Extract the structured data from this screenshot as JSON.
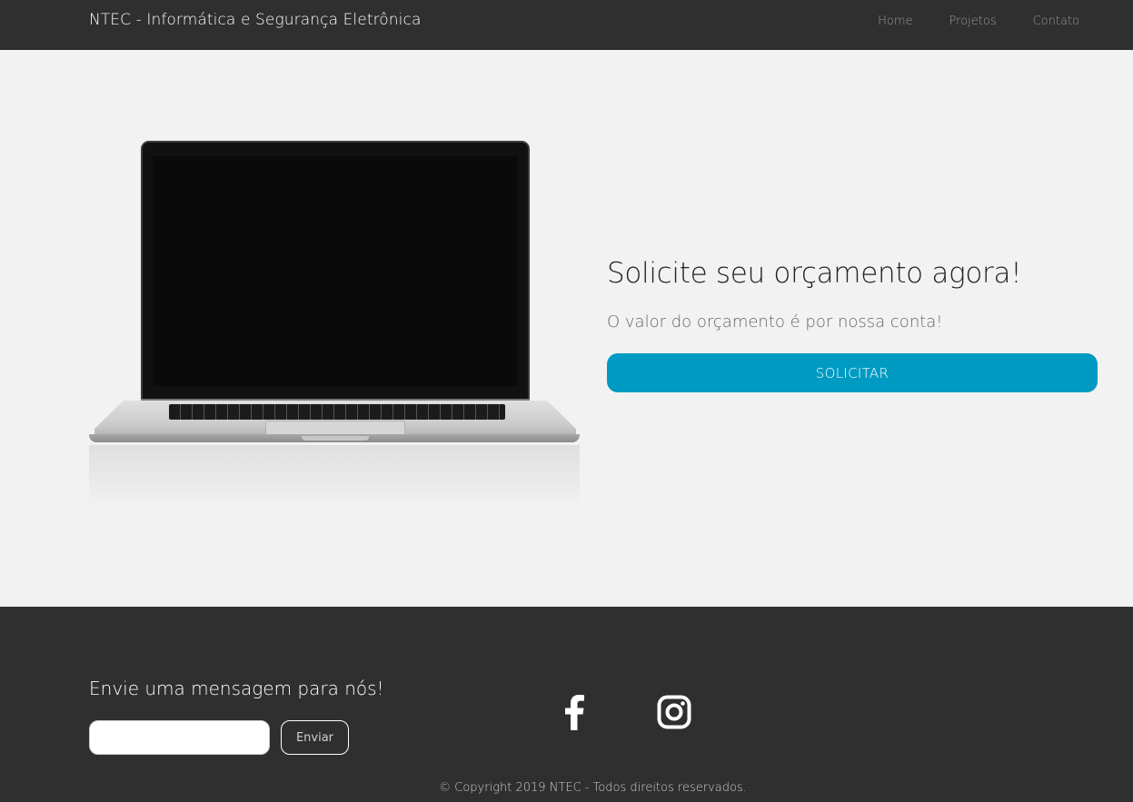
{
  "navbar": {
    "brand": "NTEC - Informática e Segurança Eletrônica",
    "links": [
      "Home",
      "Projetos",
      "Contato"
    ]
  },
  "hero": {
    "title": "Solicite seu orçamento agora!",
    "subtitle": "O valor do orçamento é por nossa conta!",
    "button_label": "SOLICITAR",
    "image": "laptop-image"
  },
  "footer": {
    "title": "Envie uma mensagem para nós!",
    "input_value": "",
    "send_label": "Enviar",
    "social_icons": [
      "facebook-icon",
      "instagram-icon"
    ],
    "copyright": "© Copyright 2019 NTEC - Todos direitos reservados."
  },
  "colors": {
    "navbar_bg": "#2f2f2f",
    "hero_bg": "#f2f2f2",
    "accent": "#009ac3",
    "footer_bg": "#2f2f2f"
  }
}
